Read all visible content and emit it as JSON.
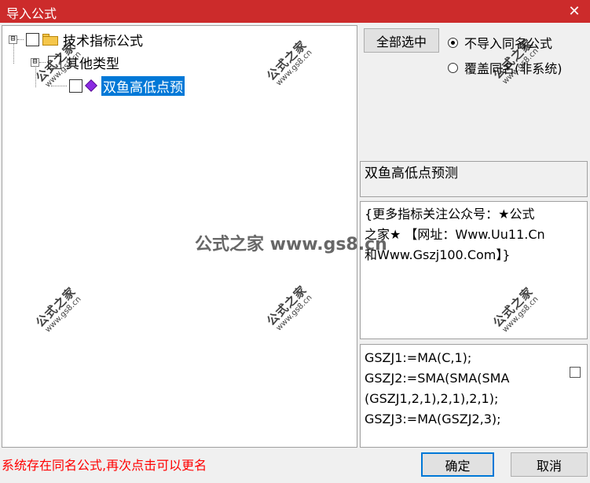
{
  "window": {
    "title": "导入公式",
    "close_glyph": "✕"
  },
  "tree": {
    "root": {
      "expander": "⊟",
      "label": "技术指标公式"
    },
    "group": {
      "expander": "⊟",
      "label": "其他类型"
    },
    "item": {
      "label": "双鱼高低点预",
      "selected": true
    }
  },
  "actions": {
    "select_all": "全部选中",
    "option_no_import": "不导入同名公式",
    "option_overwrite": "覆盖同名(非系统)",
    "selected_option": "option_no_import"
  },
  "formula": {
    "name": "双鱼高低点预测",
    "description": "{更多指标关注公众号：★公式\n之家★ 【网址：Www.Uu11.Cn\n和Www.Gszj100.Com】}",
    "code": "GSZJ1:=MA(C,1);\nGSZJ2:=SMA(SMA(SMA\n(GSZJ1,2,1),2,1),2,1);\nGSZJ3:=MA(GSZJ2,3);"
  },
  "status_text": "系统存在同名公式,再次点击可以更名",
  "buttons": {
    "ok": "确定",
    "cancel": "取消"
  },
  "watermark": {
    "center": "公式之家 www.gs8.cn",
    "stamp_title": "公式之家",
    "stamp_url": "www.gs8.cn"
  },
  "colors": {
    "titlebar": "#cc2b2b",
    "selection": "#0078d7",
    "status": "#ff0000"
  }
}
